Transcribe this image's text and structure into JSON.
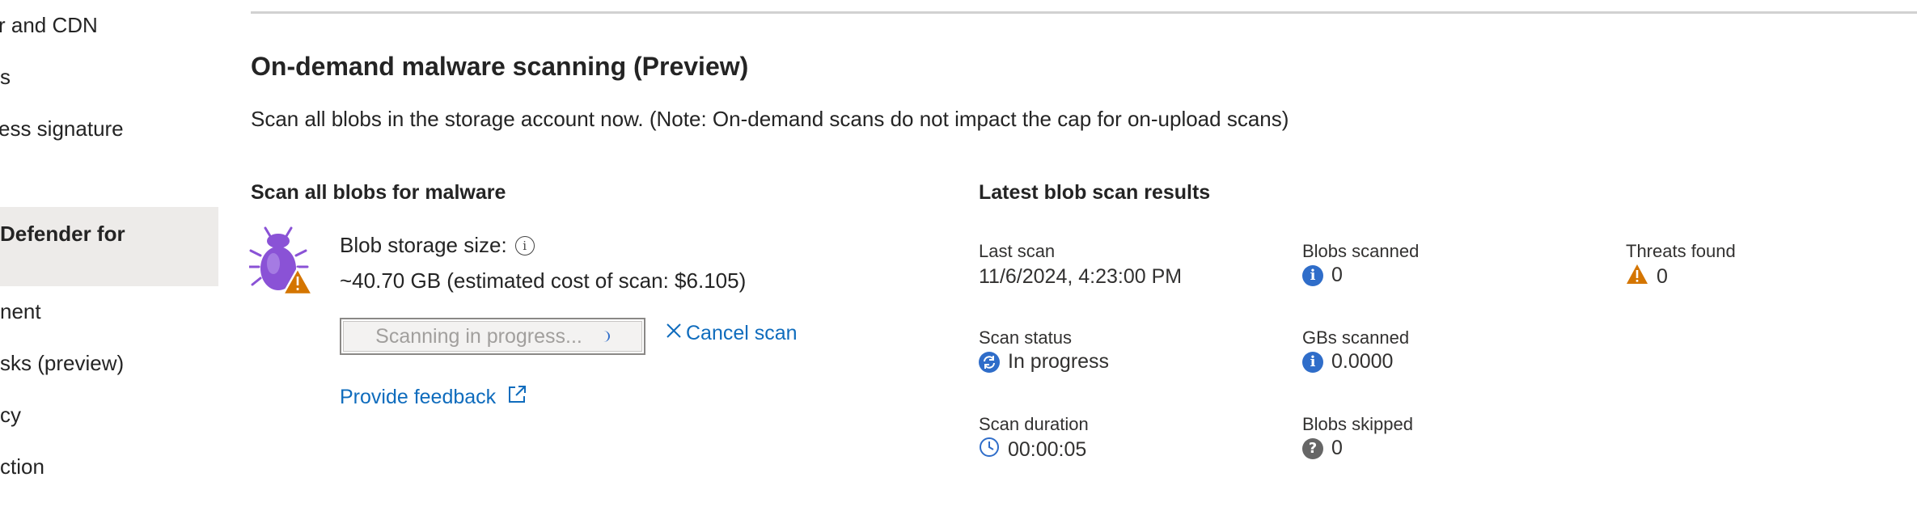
{
  "sidebar": {
    "items": [
      {
        "label": "Azure CDN and CDN",
        "visible": "r and CDN"
      },
      {
        "label": "Access keys",
        "visible": "s"
      },
      {
        "label": "Shared access signature",
        "visible": "ess signature"
      },
      {
        "label": "Microsoft Defender for Cloud",
        "visible": "Defender for",
        "selected": true
      },
      {
        "label": "Lifecycle management",
        "visible": "nent"
      },
      {
        "label": "Storage tasks (preview)",
        "visible": "sks (preview)"
      },
      {
        "label": "Object replication policy",
        "visible": "cy"
      },
      {
        "label": "Data protection",
        "visible": "ction"
      }
    ]
  },
  "section": {
    "title": "On-demand malware scanning (Preview)",
    "description": "Scan all blobs in the storage account now. (Note: On-demand scans do not impact the cap for on-upload scans)"
  },
  "scan_panel": {
    "title": "Scan all blobs for malware",
    "storage_label": "Blob storage size:",
    "storage_value": "~40.70 GB (estimated cost of scan: $6.105)",
    "scan_button_label": "Scanning in progress...",
    "cancel_label": "Cancel scan",
    "feedback_label": "Provide feedback"
  },
  "results": {
    "title": "Latest blob scan results",
    "last_scan_label": "Last scan",
    "last_scan_value": "11/6/2024, 4:23:00 PM",
    "scan_status_label": "Scan status",
    "scan_status_value": "In progress",
    "scan_duration_label": "Scan duration",
    "scan_duration_value": "00:00:05",
    "blobs_scanned_label": "Blobs scanned",
    "blobs_scanned_value": "0",
    "gbs_scanned_label": "GBs scanned",
    "gbs_scanned_value": "0.0000",
    "blobs_skipped_label": "Blobs skipped",
    "blobs_skipped_value": "0",
    "threats_found_label": "Threats found",
    "threats_found_value": "0"
  },
  "icons": {
    "bug": "bug-warning-icon",
    "info": "info-icon",
    "warning": "warning-triangle-icon",
    "sync": "sync-icon",
    "clock": "clock-icon",
    "question": "question-icon",
    "external": "external-link-icon",
    "close": "close-icon"
  },
  "colors": {
    "accent": "#0f6cbd",
    "bug_purple": "#8a52d6",
    "warning_orange": "#d47500",
    "info_blue": "#2f6dc9",
    "selected_bg": "#edebe9"
  }
}
